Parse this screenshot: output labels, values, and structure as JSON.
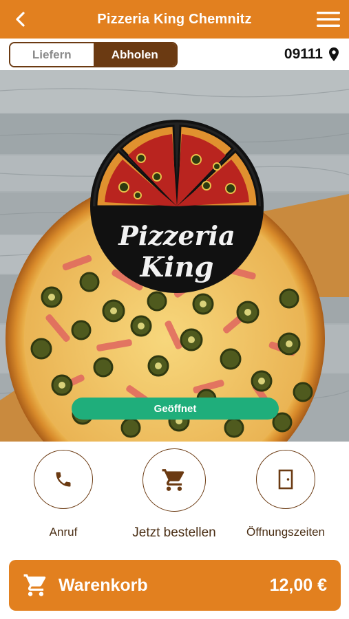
{
  "header": {
    "title": "Pizzeria King Chemnitz",
    "back_icon": "chevron-left-icon",
    "menu_icon": "hamburger-menu-icon",
    "background_color": "#e2801f"
  },
  "order_mode": {
    "options": [
      {
        "label": "Liefern",
        "selected": false
      },
      {
        "label": "Abholen",
        "selected": true
      }
    ],
    "accent_color": "#6b3a12"
  },
  "location": {
    "postal_code": "09111",
    "icon": "map-pin-icon"
  },
  "hero": {
    "logo_text_line1": "Pizzeria",
    "logo_text_line2": "King",
    "status": "Geöffnet",
    "status_color": "#1fae7b"
  },
  "actions": [
    {
      "label": "Anruf",
      "icon": "phone-icon"
    },
    {
      "label": "Jetzt bestellen",
      "icon": "shopping-cart-icon"
    },
    {
      "label": "Öffnungszeiten",
      "icon": "door-icon"
    }
  ],
  "cart": {
    "label": "Warenkorb",
    "total": "12,00 €",
    "icon": "shopping-cart-icon"
  }
}
